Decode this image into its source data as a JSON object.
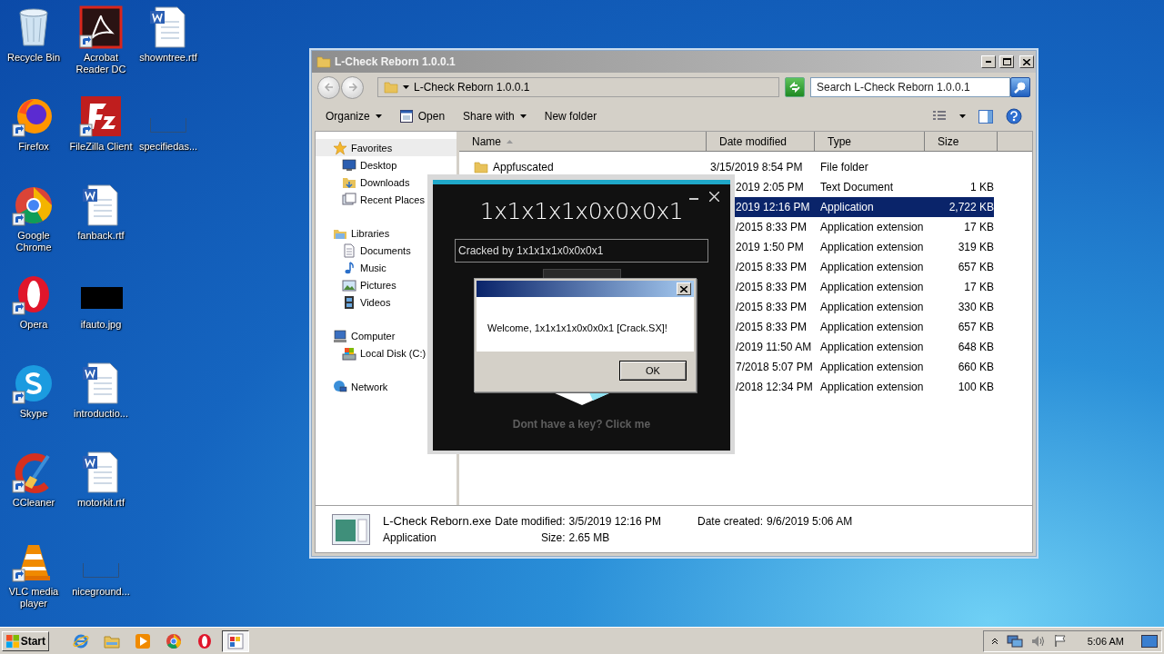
{
  "desktop_icons": [
    {
      "label": "Recycle Bin",
      "kind": "trash",
      "shortcut": false
    },
    {
      "label": "Firefox",
      "kind": "firefox",
      "shortcut": true
    },
    {
      "label": "Google Chrome",
      "kind": "chrome",
      "shortcut": true
    },
    {
      "label": "Opera",
      "kind": "opera",
      "shortcut": true
    },
    {
      "label": "Skype",
      "kind": "skype",
      "shortcut": true
    },
    {
      "label": "CCleaner",
      "kind": "ccleaner",
      "shortcut": true
    },
    {
      "label": "VLC media player",
      "kind": "vlc",
      "shortcut": true
    },
    {
      "label": "Acrobat Reader DC",
      "kind": "pdf",
      "shortcut": true
    },
    {
      "label": "FileZilla Client",
      "kind": "ftp",
      "shortcut": true
    },
    {
      "label": "fanback.rtf",
      "kind": "doc",
      "shortcut": false
    },
    {
      "label": "ifauto.jpg",
      "kind": "image",
      "shortcut": false
    },
    {
      "label": "introductio...",
      "kind": "doc",
      "shortcut": false
    },
    {
      "label": "motorkit.rtf",
      "kind": "doc",
      "shortcut": false
    },
    {
      "label": "niceground...",
      "kind": "blank",
      "shortcut": false
    },
    {
      "label": "showntree.rtf",
      "kind": "doc",
      "shortcut": false
    },
    {
      "label": "specifiedas...",
      "kind": "blank",
      "shortcut": false
    }
  ],
  "explorer": {
    "title": "L-Check Reborn 1.0.0.1",
    "address": "L-Check Reborn 1.0.0.1",
    "search": {
      "placeholder": "Search L-Check Reborn 1.0.0.1"
    },
    "commands": [
      {
        "label": "Organize",
        "kind": "menu"
      },
      {
        "label": "Open",
        "kind": "icon"
      },
      {
        "label": "Share with",
        "kind": "menu"
      },
      {
        "label": "New folder",
        "kind": "plain"
      }
    ],
    "nav": [
      {
        "label": "Favorites",
        "kind": "star",
        "selected": true,
        "children": [
          {
            "label": "Desktop",
            "kind": "desktop",
            "selected": false
          },
          {
            "label": "Downloads",
            "kind": "downloads",
            "selected": false
          },
          {
            "label": "Recent Places",
            "kind": "recent",
            "selected": false
          }
        ]
      },
      {
        "label": "Libraries",
        "kind": "library",
        "selected": false,
        "children": [
          {
            "label": "Documents",
            "kind": "documents",
            "selected": false
          },
          {
            "label": "Music",
            "kind": "music",
            "selected": false
          },
          {
            "label": "Pictures",
            "kind": "pictures",
            "selected": false
          },
          {
            "label": "Videos",
            "kind": "videos",
            "selected": false
          }
        ]
      },
      {
        "label": "Computer",
        "kind": "computer",
        "selected": false,
        "children": [
          {
            "label": "Local Disk (C:)",
            "kind": "disk",
            "selected": false
          }
        ]
      },
      {
        "label": "Network",
        "kind": "network",
        "selected": false
      }
    ],
    "columns": [
      {
        "label": "Name",
        "sorted": true
      },
      {
        "label": "Date modified",
        "sorted": false
      },
      {
        "label": "Type",
        "sorted": false
      },
      {
        "label": "Size",
        "sorted": false
      }
    ],
    "rows": [
      {
        "name": "Appfuscated",
        "kind": "folder",
        "date": "3/15/2019 8:54 PM",
        "type": "File folder",
        "selected": false
      },
      {
        "date": "2019 2:05 PM",
        "type": "Text Document",
        "size": "1 KB",
        "selected": false
      },
      {
        "date": "2019 12:16 PM",
        "type": "Application",
        "size": "2,722 KB",
        "selected": true
      },
      {
        "date": "/2015 8:33 PM",
        "type": "Application extension",
        "size": "17 KB",
        "selected": false
      },
      {
        "date": "2019 1:50 PM",
        "type": "Application extension",
        "size": "319 KB",
        "selected": false
      },
      {
        "date": "/2015 8:33 PM",
        "type": "Application extension",
        "size": "657 KB",
        "selected": false
      },
      {
        "date": "/2015 8:33 PM",
        "type": "Application extension",
        "size": "17 KB",
        "selected": false
      },
      {
        "date": "/2015 8:33 PM",
        "type": "Application extension",
        "size": "330 KB",
        "selected": false
      },
      {
        "date": "/2015 8:33 PM",
        "type": "Application extension",
        "size": "657 KB",
        "selected": false
      },
      {
        "date": "/2019 11:50 AM",
        "type": "Application extension",
        "size": "648 KB",
        "selected": false
      },
      {
        "date": "7/2018 5:07 PM",
        "type": "Application extension",
        "size": "660 KB",
        "selected": false
      },
      {
        "date": "/2018 12:34 PM",
        "type": "Application extension",
        "size": "100 KB",
        "selected": false
      }
    ],
    "details": {
      "name": "L-Check Reborn.exe",
      "type": "Application",
      "modified_label": "Date modified:",
      "modified": "3/5/2019 12:16 PM",
      "size_label": "Size:",
      "size": "2.65 MB",
      "created_label": "Date created:",
      "created": "9/6/2019 5:06 AM"
    }
  },
  "crack_app": {
    "title": "1x1x1x1x0x0x0x1",
    "field_value": "Cracked by 1x1x1x1x0x0x0x1",
    "link": "Dont have a key? Click me"
  },
  "message_box": {
    "text": "Welcome, 1x1x1x1x0x0x0x1 [Crack.SX]!",
    "ok": "OK"
  },
  "taskbar": {
    "start": "Start",
    "apps": [
      {
        "kind": "ie",
        "selected": false
      },
      {
        "kind": "explorer",
        "selected": false
      },
      {
        "kind": "media",
        "selected": false
      },
      {
        "kind": "chrome",
        "selected": false
      },
      {
        "kind": "opera",
        "selected": false
      },
      {
        "kind": "app",
        "selected": true
      }
    ],
    "clock": "5:06 AM"
  }
}
